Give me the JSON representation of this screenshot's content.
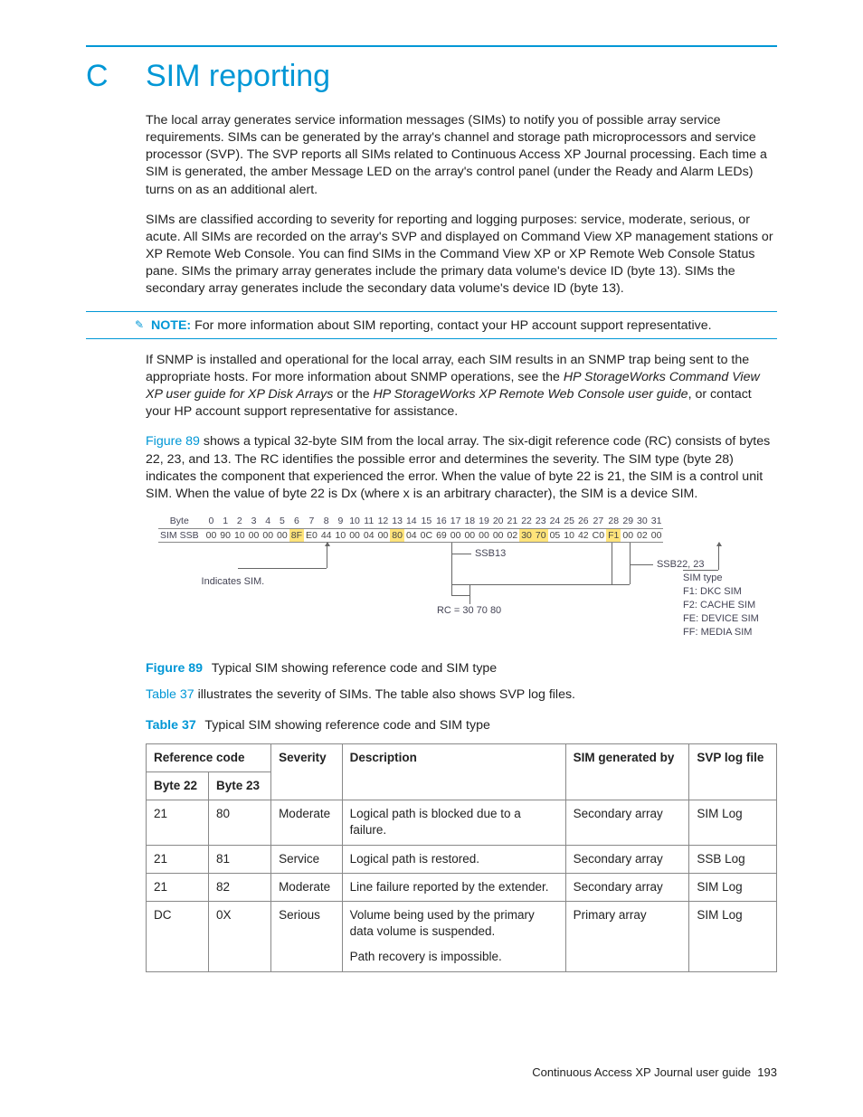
{
  "appendix": {
    "letter": "C",
    "title": "SIM reporting"
  },
  "paras": {
    "p1": "The local array generates service information messages (SIMs) to notify you of possible array service requirements. SIMs can be generated by the array's channel and storage path microprocessors and service processor (SVP). The SVP reports all SIMs related to Continuous Access XP Journal processing. Each time a SIM is generated, the amber Message LED on the array's control panel (under the Ready and Alarm LEDs) turns on as an additional alert.",
    "p2": "SIMs are classified according to severity for reporting and logging purposes: service, moderate, serious, or acute. All SIMs are recorded on the array's SVP and displayed on Command View XP management stations or XP Remote Web Console. You can find SIMs in the Command View XP or XP Remote Web Console Status pane. SIMs the primary array generates include the primary data volume's device ID (byte 13). SIMs the secondary array generates include the secondary data volume's device ID (byte 13).",
    "note_label": "NOTE:",
    "note_text": "For more information about SIM reporting, contact your HP account support representative.",
    "p3a": "If SNMP is installed and operational for the local array, each SIM results in an SNMP trap being sent to the appropriate hosts. For more information about SNMP operations, see the ",
    "p3b": "HP StorageWorks Command View XP user guide for XP Disk Arrays",
    "p3c": " or the ",
    "p3d": "HP StorageWorks XP Remote Web Console user guide",
    "p3e": ", or contact your HP account support representative for assistance.",
    "p4a": "Figure 89",
    "p4b": " shows a typical 32-byte SIM from the local array. The six-digit reference code (RC) consists of bytes 22, 23, and 13. The RC identifies the possible error and determines the severity. The SIM type (byte 28) indicates the component that experienced the error. When the value of byte 22 is 21, the SIM is a control unit SIM. When the value of byte 22 is Dx (where x is an arbitrary character), the SIM is a device SIM.",
    "p5a": "Table 37",
    "p5b": " illustrates the severity of SIMs. The table also shows SVP log files."
  },
  "diagram": {
    "byte_label": "Byte",
    "ssb_label": "SIM SSB",
    "bytes_header": [
      "0",
      "1",
      "2",
      "3",
      "4",
      "5",
      "6",
      "7",
      "8",
      "9",
      "10",
      "11",
      "12",
      "13",
      "14",
      "15",
      "16",
      "17",
      "18",
      "19",
      "20",
      "21",
      "22",
      "23",
      "24",
      "25",
      "26",
      "27",
      "28",
      "29",
      "30",
      "31"
    ],
    "ssb_values": [
      "00",
      "90",
      "10",
      "00",
      "00",
      "00",
      "8F",
      "E0",
      "44",
      "10",
      "00",
      "04",
      "00",
      "80",
      "04",
      "0C",
      "69",
      "00",
      "00",
      "00",
      "00",
      "02",
      "30",
      "70",
      "05",
      "10",
      "42",
      "C0",
      "F1",
      "00",
      "02",
      "00"
    ],
    "highlight_idx": [
      6,
      13,
      22,
      23,
      28
    ],
    "ann_indicates": "Indicates SIM.",
    "ann_ssb13": "SSB13",
    "ann_ssb2223": "SSB22, 23",
    "ann_rc": "RC = 30 70 80",
    "ann_simtype_lines": [
      "SIM type",
      "F1: DKC SIM",
      "F2: CACHE SIM",
      "FE: DEVICE SIM",
      "FF: MEDIA SIM"
    ]
  },
  "captions": {
    "fig89_label": "Figure 89",
    "fig89_text": "Typical SIM showing reference code and SIM type",
    "tbl37_label": "Table 37",
    "tbl37_text": "Typical SIM showing reference code and SIM type"
  },
  "table": {
    "headers": {
      "refcode": "Reference code",
      "byte22": "Byte 22",
      "byte23": "Byte 23",
      "severity": "Severity",
      "description": "Description",
      "generated": "SIM generated by",
      "logfile": "SVP log file"
    },
    "rows": [
      {
        "b22": "21",
        "b23": "80",
        "sev": "Moderate",
        "desc": [
          "Logical path is blocked due to a failure."
        ],
        "gen": "Secondary array",
        "log": "SIM Log"
      },
      {
        "b22": "21",
        "b23": "81",
        "sev": "Service",
        "desc": [
          "Logical path is restored."
        ],
        "gen": "Secondary array",
        "log": "SSB Log"
      },
      {
        "b22": "21",
        "b23": "82",
        "sev": "Moderate",
        "desc": [
          "Line failure reported by the extender."
        ],
        "gen": "Secondary array",
        "log": "SIM Log"
      },
      {
        "b22": "DC",
        "b23": "0X",
        "sev": "Serious",
        "desc": [
          "Volume being used by the primary data volume is suspended.",
          "Path recovery is impossible."
        ],
        "gen": "Primary array",
        "log": "SIM Log"
      }
    ]
  },
  "footer": {
    "text": "Continuous Access XP Journal user guide",
    "page": "193"
  },
  "chart_data": {
    "type": "table",
    "title": "Typical SIM showing reference code and SIM type",
    "columns": [
      "Byte 22",
      "Byte 23",
      "Severity",
      "Description",
      "SIM generated by",
      "SVP log file"
    ],
    "rows": [
      [
        "21",
        "80",
        "Moderate",
        "Logical path is blocked due to a failure.",
        "Secondary array",
        "SIM Log"
      ],
      [
        "21",
        "81",
        "Service",
        "Logical path is restored.",
        "Secondary array",
        "SSB Log"
      ],
      [
        "21",
        "82",
        "Moderate",
        "Line failure reported by the extender.",
        "Secondary array",
        "SIM Log"
      ],
      [
        "DC",
        "0X",
        "Serious",
        "Volume being used by the primary data volume is suspended. Path recovery is impossible.",
        "Primary array",
        "SIM Log"
      ]
    ]
  }
}
